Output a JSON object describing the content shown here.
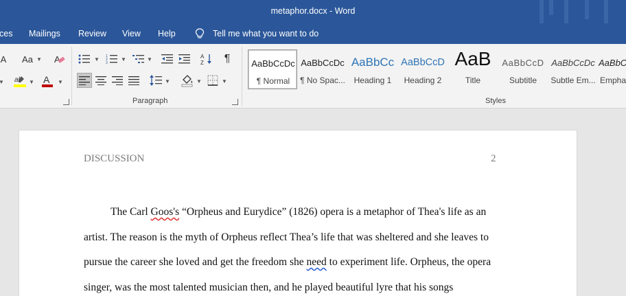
{
  "window": {
    "title": "metaphor.docx  -  Word"
  },
  "tabs": [
    {
      "label": "ces"
    },
    {
      "label": "Mailings"
    },
    {
      "label": "Review"
    },
    {
      "label": "View"
    },
    {
      "label": "Help"
    }
  ],
  "tell_me": {
    "label": "Tell me what you want to do"
  },
  "ribbon": {
    "font_size_label": "Aa",
    "paragraph_label": "Paragraph",
    "styles_label": "Styles",
    "styles": [
      {
        "sample": "AaBbCcDc",
        "name": "¶ Normal"
      },
      {
        "sample": "AaBbCcDc",
        "name": "¶ No Spac..."
      },
      {
        "sample": "AaBbCc",
        "name": "Heading 1"
      },
      {
        "sample": "AaBbCcD",
        "name": "Heading 2"
      },
      {
        "sample": "AaB",
        "name": "Title"
      },
      {
        "sample": "AaBbCcD",
        "name": "Subtitle"
      },
      {
        "sample": "AaBbCcDc",
        "name": "Subtle Em..."
      },
      {
        "sample": "AaBbCcDc",
        "name": "Empha"
      }
    ]
  },
  "document": {
    "header_left": "DISCUSSION",
    "header_right": "2",
    "line1": {
      "a": "The Carl ",
      "b": "Goos's",
      "c": " “Orpheus and Eurydice” (1826) opera is a metaphor of Thea's life as an"
    },
    "line2": "artist. The reason is the myth of Orpheus reflect Thea’s life that was sheltered and she leaves to",
    "line3": {
      "a": "pursue the career she loved and get the freedom she ",
      "b": "need",
      "c": " to experiment life. Orpheus, the opera"
    },
    "line4": "singer, was the most talented musician then, and he played beautiful lyre that his songs"
  },
  "colors": {
    "title_bar": "#2b579a",
    "ribbon_bg": "#f3f3f3",
    "doc_bg": "#e6e6e6",
    "heading_blue": "#2e74b5",
    "font_color_red": "#c00000",
    "highlight_yellow": "#ffff00"
  }
}
